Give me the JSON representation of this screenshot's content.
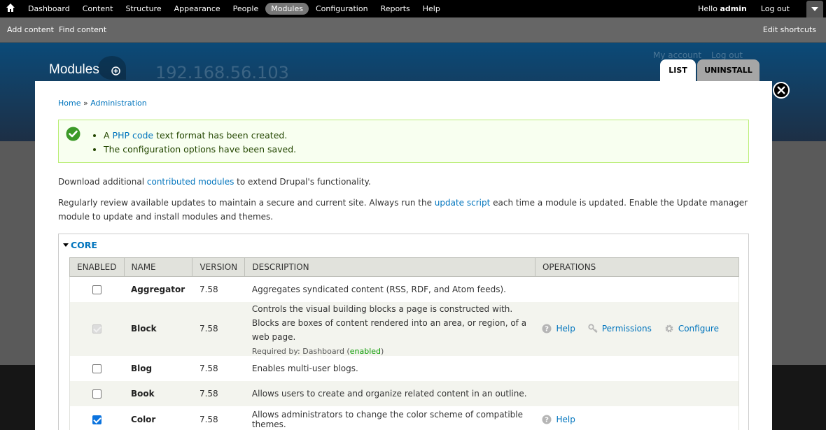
{
  "toolbar": {
    "menu": [
      "Dashboard",
      "Content",
      "Structure",
      "Appearance",
      "People",
      "Modules",
      "Configuration",
      "Reports",
      "Help"
    ],
    "active": "Modules",
    "hello": "Hello",
    "user": "admin",
    "logout": "Log out"
  },
  "shortcuts": {
    "add_content": "Add content",
    "find_content": "Find content",
    "edit_shortcuts": "Edit shortcuts"
  },
  "background": {
    "ip": "192.168.56.103",
    "my_account": "My account",
    "log_out": "Log out"
  },
  "overlay": {
    "title": "Modules",
    "tabs": {
      "list": "LIST",
      "uninstall": "UNINSTALL"
    }
  },
  "breadcrumb": {
    "home": "Home",
    "sep": "»",
    "admin": "Administration"
  },
  "messages": {
    "m1_prefix": "A ",
    "m1_link": "PHP code",
    "m1_suffix": " text format has been created.",
    "m2": "The configuration options have been saved."
  },
  "intro": {
    "p1_prefix": "Download additional ",
    "p1_link": "contributed modules",
    "p1_suffix": " to extend Drupal's functionality.",
    "p2_prefix": "Regularly review available updates to maintain a secure and current site. Always run the ",
    "p2_link": "update script",
    "p2_suffix": " each time a module is updated. Enable the Update manager module to update and install modules and themes."
  },
  "core": {
    "legend": "CORE",
    "headers": {
      "enabled": "ENABLED",
      "name": "NAME",
      "version": "VERSION",
      "description": "DESCRIPTION",
      "operations": "OPERATIONS"
    },
    "rows": [
      {
        "name": "Aggregator",
        "version": "7.58",
        "description": "Aggregates syndicated content (RSS, RDF, and Atom feeds).",
        "state": "unchecked"
      },
      {
        "name": "Block",
        "version": "7.58",
        "description": "Controls the visual building blocks a page is constructed with. Blocks are boxes of content rendered into an area, or region, of a web page.",
        "required_prefix": "Required by: Dashboard (",
        "required_status": "enabled",
        "required_suffix": ")",
        "state": "checked-disabled",
        "help": "Help",
        "permissions": "Permissions",
        "configure": "Configure"
      },
      {
        "name": "Blog",
        "version": "7.58",
        "description": "Enables multi-user blogs.",
        "state": "unchecked"
      },
      {
        "name": "Book",
        "version": "7.58",
        "description": "Allows users to create and organize related content in an outline.",
        "state": "unchecked"
      },
      {
        "name": "Color",
        "version": "7.58",
        "description": "Allows administrators to change the color scheme of compatible themes.",
        "state": "checked",
        "help": "Help"
      }
    ]
  }
}
